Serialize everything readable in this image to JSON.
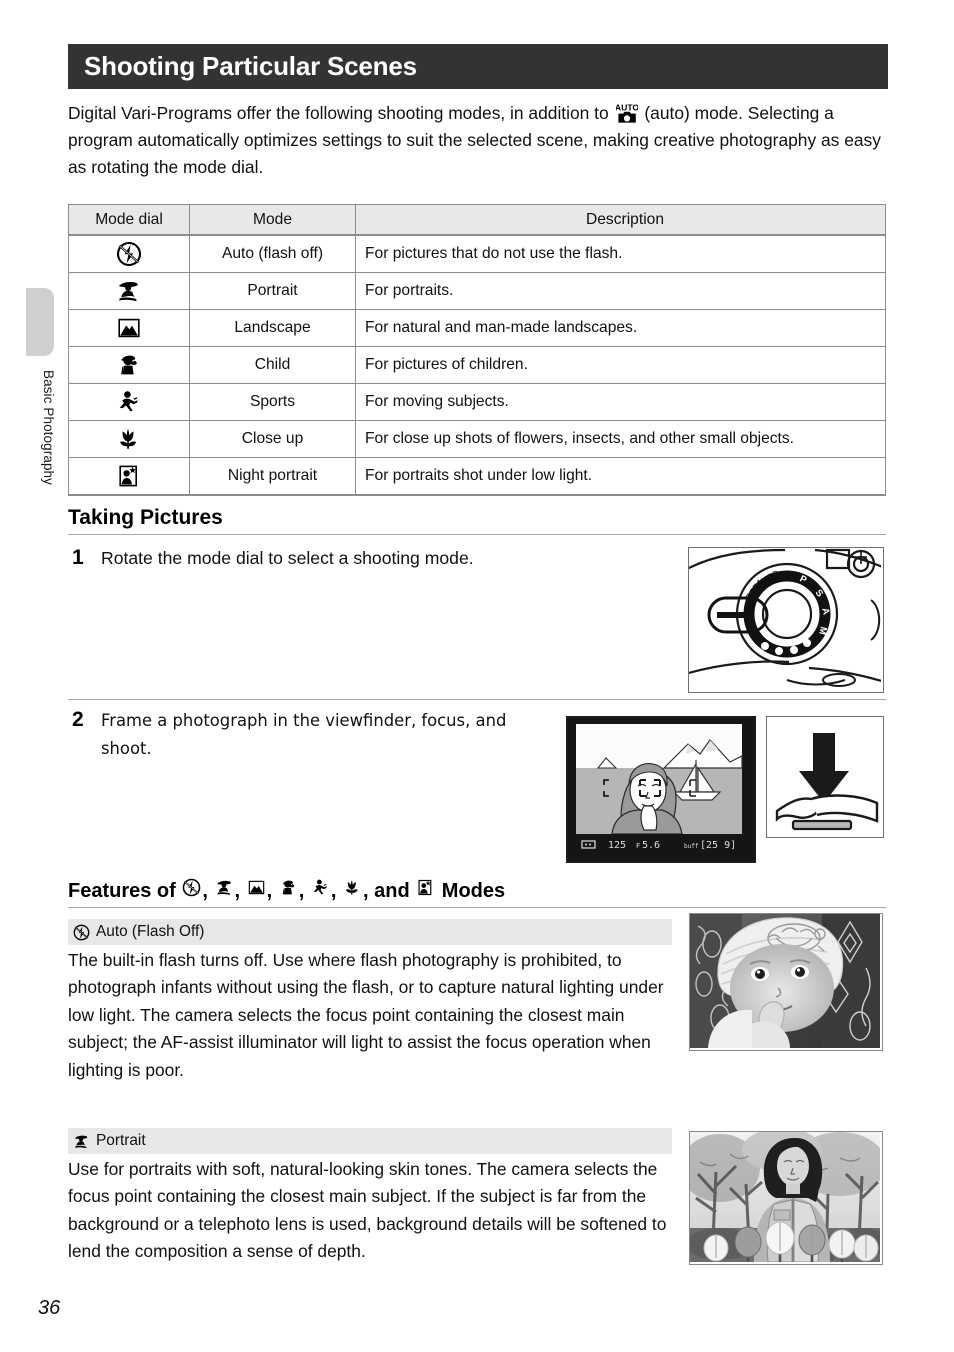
{
  "sidebar": {
    "chapter_label": "Basic Photography"
  },
  "page": {
    "number": "36",
    "title": "Shooting Particular Scenes",
    "intro": "Digital Vari-Programs offer the following shooting modes, in addition to  (auto) mode. Selecting a program automatically optimizes settings to suit the selected scene, making creative photography as easy as rotating the mode dial.",
    "intro_part1": "Digital Vari-Programs offer the following shooting modes, in addition to",
    "intro_part2": "(auto) mode. Selecting a program automatically optimizes settings to suit the selected scene, making creative photography as easy as rotating the mode dial."
  },
  "mode_table": {
    "headers": [
      "Mode dial",
      "Mode",
      "Description"
    ],
    "rows": [
      {
        "icon": "flash-off-icon",
        "mode": "Auto (flash off)",
        "description": "For pictures that do not use the flash."
      },
      {
        "icon": "portrait-icon",
        "mode": "Portrait",
        "description": "For portraits."
      },
      {
        "icon": "landscape-icon",
        "mode": "Landscape",
        "description": "For natural and man-made landscapes."
      },
      {
        "icon": "child-icon",
        "mode": "Child",
        "description": "For pictures of children."
      },
      {
        "icon": "sports-icon",
        "mode": "Sports",
        "description": "For moving subjects."
      },
      {
        "icon": "close-up-icon",
        "mode": "Close up",
        "description": "For close up shots of flowers, insects, and other small objects."
      },
      {
        "icon": "night-portrait-icon",
        "mode": "Night portrait",
        "description": "For portraits shot under low light."
      }
    ]
  },
  "taking_pictures": {
    "heading": "Taking Pictures",
    "steps": [
      {
        "number": "1",
        "text": "Rotate the mode dial to select a shooting mode."
      },
      {
        "number": "2",
        "text": "Frame a photograph in the viewfinder, focus, and shoot."
      }
    ]
  },
  "viewfinder": {
    "shutter_speed": "125",
    "aperture": "5.6",
    "aperture_prefix": "F",
    "frames_remaining": "[25 9]",
    "meter_label": "buff"
  },
  "features": {
    "heading_prefix": "Features of",
    "heading_suffix": "Modes",
    "heading_and": ", and",
    "heading_comma": ",",
    "blocks": [
      {
        "icon": "flash-off-icon",
        "label": "Auto (Flash Off)",
        "body": "The built-in flash turns off. Use where flash photography is prohibited, to photograph infants without using the flash, or to capture natural lighting under low light. The camera selects the focus point containing the closest main subject; the AF-assist illuminator will light to assist the focus operation when lighting is poor.",
        "photo_alt": "baby-in-white-hat-photo"
      },
      {
        "icon": "portrait-icon",
        "label": "Portrait",
        "body": "Use for portraits with soft, natural-looking skin tones. The camera selects the focus point containing the closest main subject. If the subject is far from the background or a telephoto lens is used, background details will be softened to lend the composition a sense of depth.",
        "photo_alt": "woman-among-tulips-photo"
      }
    ]
  },
  "figures": {
    "mode_dial": "camera-mode-dial-illustration",
    "viewfinder": "viewfinder-framing-illustration",
    "shutter_press": "finger-pressing-shutter-illustration"
  },
  "colors": {
    "title_bar": "#333333",
    "table_header": "#e8e8e8",
    "feature_bar": "#e7e7e7",
    "rule": "#a9a9a9",
    "tab": "#cfcfcf"
  }
}
